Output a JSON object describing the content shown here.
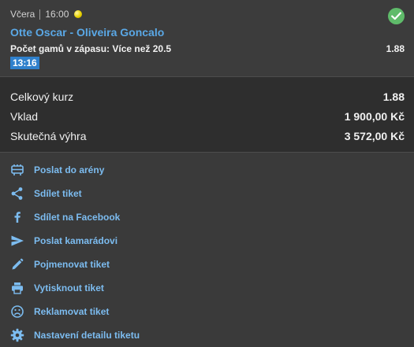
{
  "bet": {
    "day": "Včera",
    "time": "16:00",
    "match": "Otte Oscar - Oliveira Goncalo",
    "market": "Počet gamů v zápasu: Více než 20.5",
    "odd": "1.88",
    "event_time": "13:16",
    "status_icon": "check-circle-icon",
    "sport_icon": "tennis-ball-icon"
  },
  "summary": [
    {
      "label": "Celkový kurz",
      "value": "1.88"
    },
    {
      "label": "Vklad",
      "value": "1 900,00 Kč"
    },
    {
      "label": "Skutečná výhra",
      "value": "3 572,00 Kč"
    }
  ],
  "actions": [
    {
      "label": "Poslat do arény",
      "icon": "arena-icon"
    },
    {
      "label": "Sdílet tiket",
      "icon": "share-icon"
    },
    {
      "label": "Sdílet na Facebook",
      "icon": "facebook-icon"
    },
    {
      "label": "Poslat kamarádovi",
      "icon": "send-icon"
    },
    {
      "label": "Pojmenovat tiket",
      "icon": "pencil-icon"
    },
    {
      "label": "Vytisknout tiket",
      "icon": "print-icon"
    },
    {
      "label": "Reklamovat tiket",
      "icon": "sad-face-icon"
    },
    {
      "label": "Nastavení detailu tiketu",
      "icon": "gear-icon"
    }
  ],
  "colors": {
    "accent": "#5aa8e6",
    "success": "#5fbb6a",
    "time_badge": "#2f80cc"
  }
}
